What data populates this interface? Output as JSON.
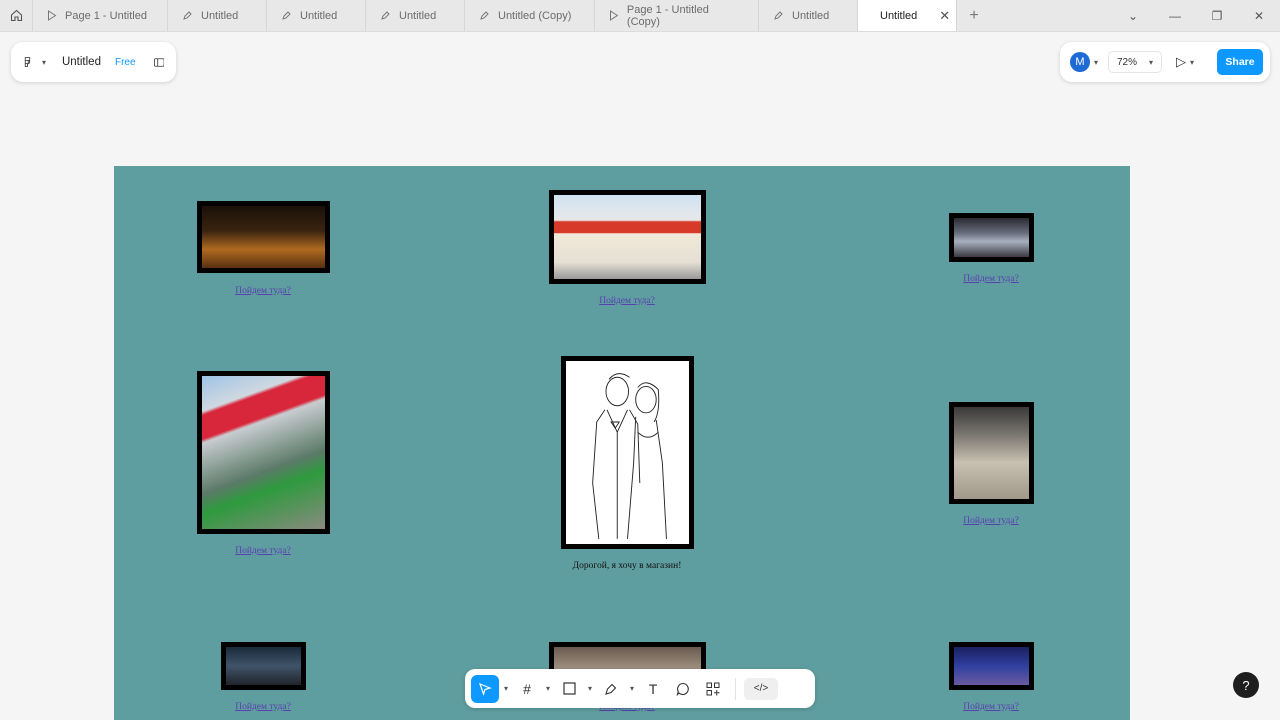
{
  "tabs": [
    {
      "label": "Page 1 - Untitled",
      "icon": "play-icon"
    },
    {
      "label": "Untitled",
      "icon": "pen-icon"
    },
    {
      "label": "Untitled",
      "icon": "pen-icon"
    },
    {
      "label": "Untitled",
      "icon": "pen-icon"
    },
    {
      "label": "Untitled (Copy)",
      "icon": "pen-icon"
    },
    {
      "label": "Page 1 - Untitled (Copy)",
      "icon": "play-icon"
    },
    {
      "label": "Untitled",
      "icon": "pen-icon"
    },
    {
      "label": "Untitled",
      "icon": "pen-icon",
      "active": true
    }
  ],
  "header": {
    "file_title": "Untitled",
    "plan_badge": "Free"
  },
  "controls": {
    "avatar_initial": "M",
    "zoom": "72%",
    "share_label": "Share"
  },
  "canvas": {
    "link_text": "Пойдем туда?",
    "center_caption": "Дорогой, я хочу в магазин!",
    "background": "#5f9ea0"
  },
  "colors": {
    "accent": "#0d99ff",
    "frame_bg": "#5f9ea0"
  }
}
